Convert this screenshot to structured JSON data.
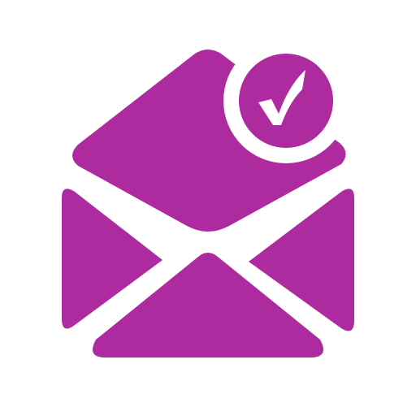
{
  "icon": {
    "name": "opened-envelope-with-checkmark",
    "colors": {
      "fill": "#AE2A9F",
      "background": "#FFFFFF"
    }
  }
}
